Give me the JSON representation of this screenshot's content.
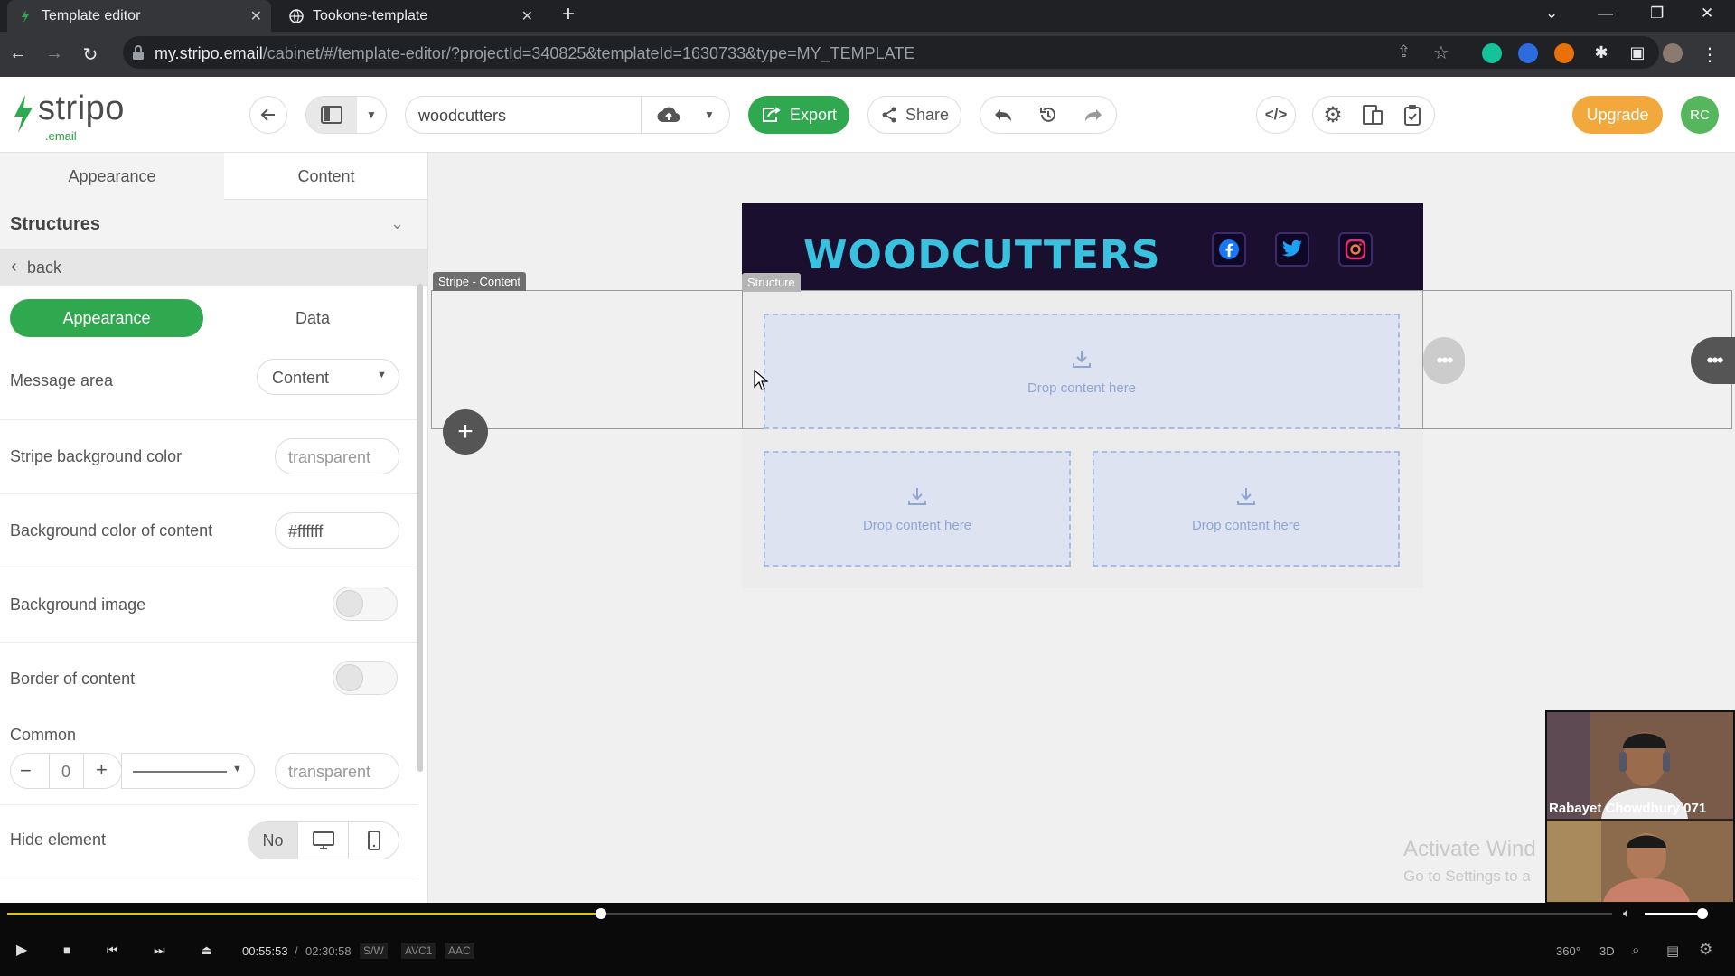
{
  "browser": {
    "tabs": [
      {
        "title": "Template editor",
        "active": true
      },
      {
        "title": "Tookone-template",
        "active": false
      }
    ],
    "url_domain": "my.stripo.email",
    "url_path": "/cabinet/#/template-editor/?projectId=340825&templateId=1630733&type=MY_TEMPLATE"
  },
  "app": {
    "logo_word": "stripo",
    "logo_sub": ".email",
    "template_name": "woodcutters",
    "export_label": "Export",
    "share_label": "Share",
    "upgrade_label": "Upgrade",
    "avatar_initials": "RC",
    "colors": {
      "accent": "#2fa84f",
      "upgrade": "#f2a83b",
      "email_header_bg": "#1a0f2e",
      "email_title": "#38c2e0"
    }
  },
  "sidebar": {
    "tabs": [
      "Appearance",
      "Content"
    ],
    "section_title": "Structures",
    "back_label": "back",
    "subtabs": [
      "Appearance",
      "Data"
    ],
    "message_area": {
      "label": "Message area",
      "value": "Content"
    },
    "stripe_bg": {
      "label": "Stripe background color",
      "value": "transparent"
    },
    "content_bg": {
      "label": "Background color of content",
      "value": "#ffffff"
    },
    "bg_image": {
      "label": "Background image"
    },
    "border": {
      "label": "Border of content"
    },
    "common": {
      "label": "Common",
      "width": "0",
      "color": "transparent"
    },
    "hide": {
      "label": "Hide element",
      "value": "No"
    }
  },
  "canvas": {
    "email_title": "WOODCUTTERS",
    "stripe_label": "Stripe - Content",
    "structure_label": "Structure",
    "drop_text": "Drop content here"
  },
  "webcam": {
    "name": "Rabayet Chowdhury 071"
  },
  "watermark": {
    "line1": "Activate Wind",
    "line2": "Go to Settings to a"
  },
  "player": {
    "current": "00:55:53",
    "separator": "/",
    "total": "02:30:58",
    "tags": [
      "S/W",
      "AVC1",
      "AAC"
    ],
    "right_labels": [
      "360°",
      "3D"
    ],
    "progress": 0.37
  }
}
